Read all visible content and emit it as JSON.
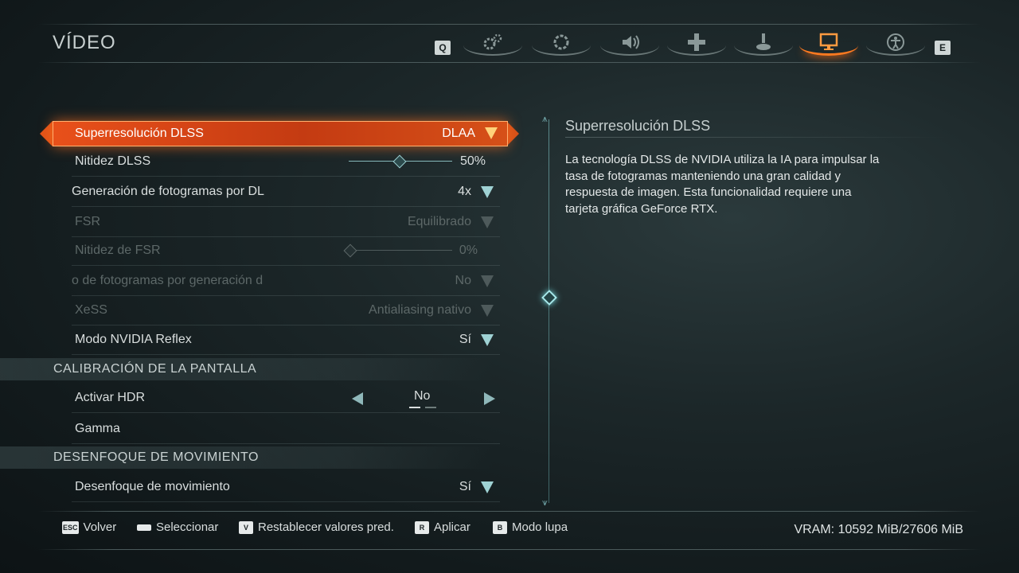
{
  "header": {
    "title": "VÍDEO",
    "left_key": "Q",
    "right_key": "E"
  },
  "tabs": [
    {
      "icon": "gears-icon",
      "active": false
    },
    {
      "icon": "gear-wheel-icon",
      "active": false
    },
    {
      "icon": "speaker-icon",
      "active": false
    },
    {
      "icon": "dpad-icon",
      "active": false
    },
    {
      "icon": "joystick-icon",
      "active": false
    },
    {
      "icon": "monitor-icon",
      "active": true
    },
    {
      "icon": "accessibility-icon",
      "active": false
    }
  ],
  "settings": {
    "dlss": {
      "label": "Superresolución DLSS",
      "value": "DLAA"
    },
    "dlss_sharpness": {
      "label": "Nitidez DLSS",
      "value": "50%",
      "level": 0.5
    },
    "frame_gen": {
      "label": "Generación de fotogramas por DL",
      "value": "4x"
    },
    "fsr": {
      "label": "FSR",
      "value": "Equilibrado"
    },
    "fsr_sharpness": {
      "label": "Nitidez de FSR",
      "value": "0%",
      "level": 0
    },
    "fsr_frame_gen": {
      "label": "o de fotogramas por generación d",
      "value": "No"
    },
    "xess": {
      "label": "XeSS",
      "value": "Antialiasing nativo"
    },
    "reflex": {
      "label": "Modo NVIDIA Reflex",
      "value": "Sí"
    }
  },
  "section_calibration": {
    "label": "CALIBRACIÓN DE LA PANTALLA"
  },
  "calibration": {
    "hdr": {
      "label": "Activar HDR",
      "value": "No"
    },
    "gamma": {
      "label": "Gamma"
    }
  },
  "section_motion": {
    "label": "DESENFOQUE DE MOVIMIENTO"
  },
  "motion": {
    "blur": {
      "label": "Desenfoque de movimiento",
      "value": "Sí"
    }
  },
  "description": {
    "title": "Superresolución DLSS",
    "text": "La tecnología DLSS de NVIDIA utiliza la IA para impulsar la tasa de fotogramas manteniendo una gran calidad y respuesta de imagen. Esta funcionalidad requiere una tarjeta gráfica GeForce RTX."
  },
  "footer": {
    "back": {
      "key": "ESC",
      "label": "Volver"
    },
    "select": {
      "key": "",
      "label": "Seleccionar"
    },
    "reset": {
      "key": "V",
      "label": "Restablecer valores pred."
    },
    "apply": {
      "key": "R",
      "label": "Aplicar"
    },
    "zoom": {
      "key": "B",
      "label": "Modo lupa"
    },
    "vram": "VRAM: 10592 MiB/27606 MiB"
  },
  "colors": {
    "accent": "#e8501a",
    "highlight": "#9fd2d4",
    "background": "#1c2729"
  }
}
